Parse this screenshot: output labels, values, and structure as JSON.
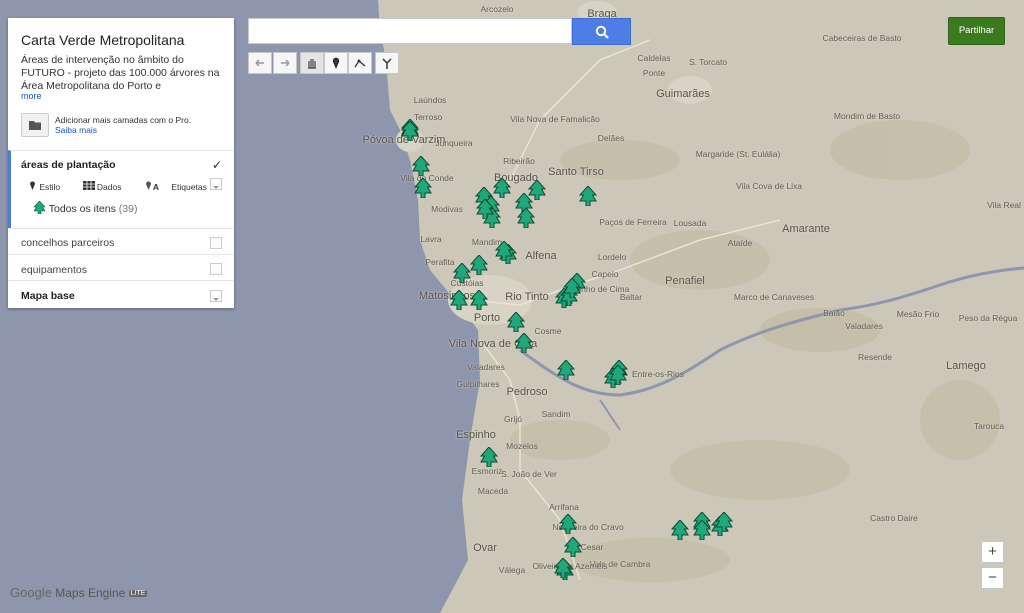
{
  "app": {
    "map_title": "Carta Verde Metropolitana",
    "description": "Áreas de intervenção no âmbito do FUTURO - projeto das 100.000 árvores na Área Metropolitana do Porto e",
    "more_link": "more",
    "pro_text": "Adicionar mais camadas com o Pro.",
    "pro_link": "Saiba mais",
    "share_label": "Partilhar",
    "logo_google": "Google",
    "logo_product": "Maps Engine",
    "logo_badge": "LITE"
  },
  "search": {
    "placeholder": "",
    "value": ""
  },
  "layers": {
    "areas": {
      "name": "áreas de plantação",
      "checked": true,
      "style_label": "Estilo",
      "data_label": "Dados",
      "labels_label": "Etiquetas",
      "all_items_label": "Todos os itens",
      "all_items_count": "(39)"
    },
    "concelhos": {
      "name": "concelhos parceiros"
    },
    "equipamentos": {
      "name": "equipamentos"
    },
    "base": {
      "name": "Mapa base"
    }
  },
  "zoom": {
    "in": "+",
    "out": "−"
  },
  "places": [
    {
      "name": "Braga",
      "big": true
    },
    {
      "name": "Arcozelo"
    },
    {
      "name": "Caldelas"
    },
    {
      "name": "S. Torcato"
    },
    {
      "name": "Ponte"
    },
    {
      "name": "Cabeceiras de Basto"
    },
    {
      "name": "Guimarães",
      "big": true
    },
    {
      "name": "Laúndos"
    },
    {
      "name": "Terroso"
    },
    {
      "name": "Vila Nova de Famalicão"
    },
    {
      "name": "Delães"
    },
    {
      "name": "Póvoa de Varzim",
      "big": true
    },
    {
      "name": "Junqueira"
    },
    {
      "name": "Ribeirão"
    },
    {
      "name": "Santo Tirso",
      "big": true
    },
    {
      "name": "Bougado",
      "big": true
    },
    {
      "name": "Margaride (St. Eulália)"
    },
    {
      "name": "Vila Cova de Lixa"
    },
    {
      "name": "Mondim de Basto"
    },
    {
      "name": "Vila Real"
    },
    {
      "name": "Vila do Conde"
    },
    {
      "name": "Modivas"
    },
    {
      "name": "Paços de Ferreira"
    },
    {
      "name": "Lousada"
    },
    {
      "name": "Amarante",
      "big": true
    },
    {
      "name": "Lavra"
    },
    {
      "name": "Mandim"
    },
    {
      "name": "Ataíde"
    },
    {
      "name": "Perafita"
    },
    {
      "name": "Alfena",
      "big": true
    },
    {
      "name": "Lordelo"
    },
    {
      "name": "Custóias"
    },
    {
      "name": "Capelo"
    },
    {
      "name": "Penafiel",
      "big": true
    },
    {
      "name": "Matosinhos",
      "big": true
    },
    {
      "name": "Rio Tinto",
      "big": true
    },
    {
      "name": "Marinho de Cima"
    },
    {
      "name": "Baltar"
    },
    {
      "name": "Marco de Canaveses"
    },
    {
      "name": "Porto",
      "big": true
    },
    {
      "name": "Cosme"
    },
    {
      "name": "Baião"
    },
    {
      "name": "Valadares"
    },
    {
      "name": "Mesão Frio"
    },
    {
      "name": "Peso da Régua"
    },
    {
      "name": "Vila Nova de Gaia",
      "big": true
    },
    {
      "name": "Resende"
    },
    {
      "name": "Lamego",
      "big": true
    },
    {
      "name": "Valadares"
    },
    {
      "name": "Entre-os-Rios"
    },
    {
      "name": "Gulpilhares"
    },
    {
      "name": "Pedroso",
      "big": true
    },
    {
      "name": "Grijó"
    },
    {
      "name": "Sandim"
    },
    {
      "name": "Tarouca"
    },
    {
      "name": "Espinho",
      "big": true
    },
    {
      "name": "Mozelos"
    },
    {
      "name": "Esmoriz"
    },
    {
      "name": "S. João de Ver"
    },
    {
      "name": "Maceda"
    },
    {
      "name": "Arrifana"
    },
    {
      "name": "Nogueira do Cravo"
    },
    {
      "name": "Castro Daire"
    },
    {
      "name": "Ovar",
      "big": true
    },
    {
      "name": "Vale de Cambra"
    },
    {
      "name": "Oliveira de Azeméis"
    },
    {
      "name": "Válega"
    },
    {
      "name": "Cesar"
    }
  ],
  "colors": {
    "sea": "#8e96ad",
    "land": "#ccc7b8",
    "tree": "#20a87a",
    "accent_blue": "#4d7ee6",
    "share_green": "#3b7a1f"
  }
}
